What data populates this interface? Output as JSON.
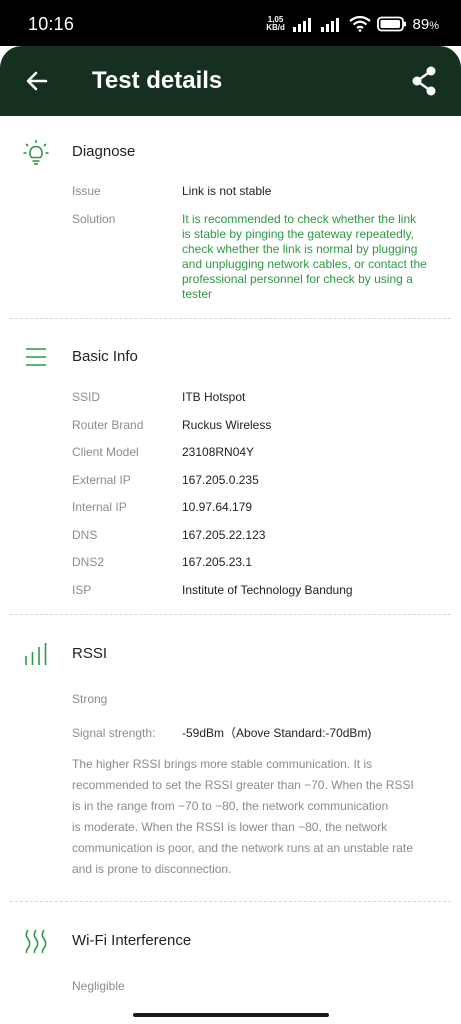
{
  "status_bar": {
    "time": "10:16",
    "net_speed_value": "1,05",
    "net_speed_unit": "KB/d",
    "battery_percent": "89",
    "battery_suffix": "%"
  },
  "app_bar": {
    "title": "Test details",
    "back_icon": "arrow-left-icon",
    "share_icon": "share-icon"
  },
  "colors": {
    "app_bar": "#16301f",
    "accent_green": "#2d9a43",
    "label_gray": "#8c8c8c"
  },
  "diagnose": {
    "title": "Diagnose",
    "icon": "lightbulb-icon",
    "issue_label": "Issue",
    "issue_value": "Link is not stable",
    "solution_label": "Solution",
    "solution_lines": [
      "It is recommended to check whether the link",
      "is stable by pinging the gateway repeatedly,",
      "check whether the link is normal by plugging",
      "and unplugging network cables, or contact the",
      "professional personnel for check by using a",
      "tester"
    ]
  },
  "basic_info": {
    "title": "Basic Info",
    "icon": "list-lines-icon",
    "rows": [
      {
        "label": "SSID",
        "value": "ITB Hotspot"
      },
      {
        "label": "Router Brand",
        "value": "Ruckus Wireless"
      },
      {
        "label": "Client Model",
        "value": "23108RN04Y"
      },
      {
        "label": "External IP",
        "value": "167.205.0.235"
      },
      {
        "label": "Internal IP",
        "value": "10.97.64.179"
      },
      {
        "label": "DNS",
        "value": "167.205.22.123"
      },
      {
        "label": "DNS2",
        "value": "167.205.23.1"
      },
      {
        "label": "ISP",
        "value": "Institute of Technology Bandung"
      }
    ]
  },
  "rssi": {
    "title": "RSSI",
    "icon": "signal-bars-icon",
    "status": "Strong",
    "strength_label": "Signal strength:",
    "strength_value": "-59dBm（Above Standard:-70dBm)",
    "description_lines": [
      "The higher RSSI brings more stable communication. It is",
      "recommended to set the RSSI greater than −70. When the RSSI",
      "is in the range from −70 to −80, the network communication",
      "is moderate. When the RSSI is lower than −80, the network",
      "communication is poor, and the network runs at an unstable rate",
      "and is prone to disconnection."
    ]
  },
  "wifi_interference": {
    "title": "Wi-Fi Interference",
    "icon": "wave-lines-icon",
    "status": "Negligible"
  }
}
